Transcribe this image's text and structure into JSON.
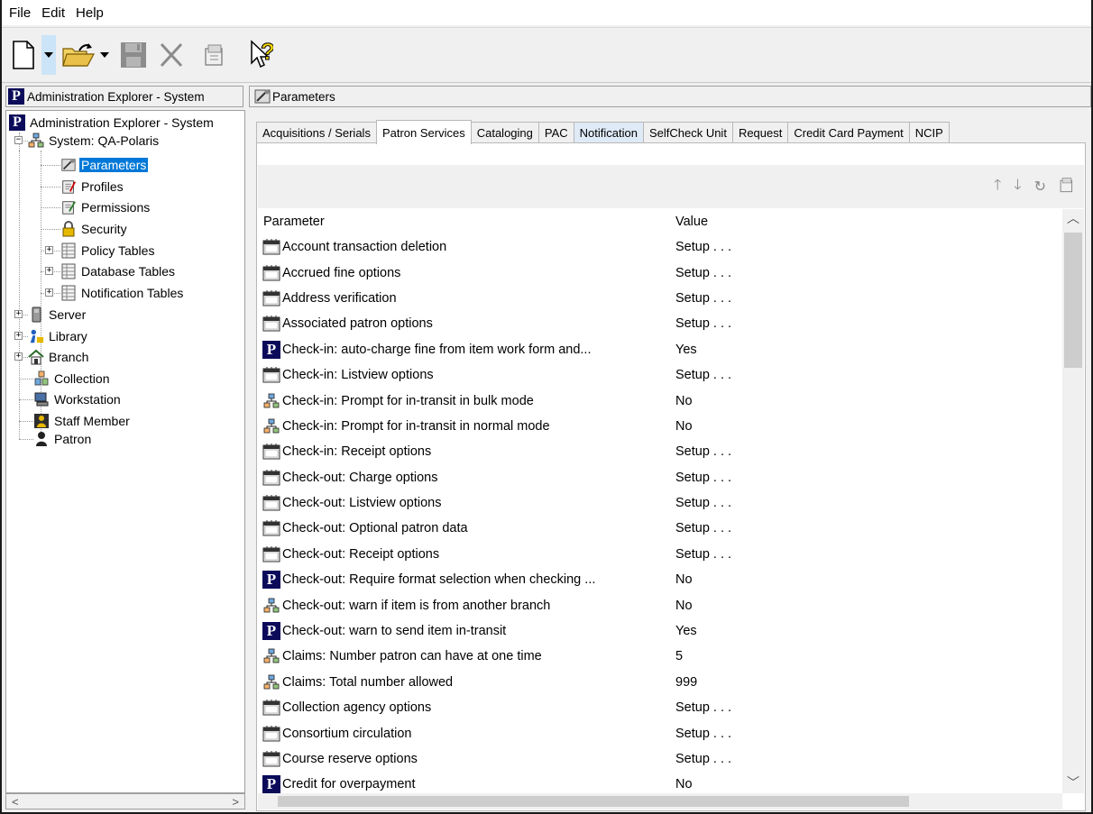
{
  "menu": [
    "File",
    "Edit",
    "Help"
  ],
  "toolbar": {
    "icons": [
      "new-document-icon",
      "open-folder-icon",
      "save-icon",
      "delete-icon",
      "properties-icon",
      "whats-this-help-icon"
    ]
  },
  "left_pane": {
    "header": "Administration Explorer - System",
    "tree": {
      "root": "Administration Explorer - System",
      "system": "System: QA-Polaris",
      "parameters": "Parameters",
      "profiles": "Profiles",
      "permissions": "Permissions",
      "security": "Security",
      "policy_tables": "Policy Tables",
      "database_tables": "Database Tables",
      "notification_tables": "Notification Tables",
      "server": "Server",
      "library": "Library",
      "branch": "Branch",
      "collection": "Collection",
      "workstation": "Workstation",
      "staff_member": "Staff Member",
      "patron": "Patron"
    },
    "selected": "Parameters"
  },
  "right_pane": {
    "header": "Parameters",
    "tabs": [
      "Acquisitions / Serials",
      "Patron Services",
      "Cataloging",
      "PAC",
      "Notification",
      "SelfCheck Unit",
      "Request",
      "Credit Card Payment",
      "NCIP"
    ],
    "selected_tab": "Patron Services",
    "hover_tab": "Notification",
    "list_toolbar_icons": [
      "arrow-up-icon",
      "arrow-down-icon",
      "refresh-icon",
      "properties-icon"
    ],
    "columns": {
      "parameter": "Parameter",
      "value": "Value"
    },
    "rows": [
      {
        "icon": "setup",
        "name": "Account transaction deletion",
        "value": "Setup . . ."
      },
      {
        "icon": "setup",
        "name": "Accrued fine options",
        "value": "Setup . . ."
      },
      {
        "icon": "setup",
        "name": "Address verification",
        "value": "Setup . . ."
      },
      {
        "icon": "setup",
        "name": "Associated patron options",
        "value": "Setup . . ."
      },
      {
        "icon": "polaris",
        "name": "Check-in: auto-charge fine from item work form and...",
        "value": "Yes"
      },
      {
        "icon": "setup",
        "name": "Check-in: Listview options",
        "value": "Setup . . ."
      },
      {
        "icon": "network",
        "name": "Check-in: Prompt for in-transit in bulk mode",
        "value": "No"
      },
      {
        "icon": "network",
        "name": "Check-in: Prompt for in-transit in normal mode",
        "value": "No"
      },
      {
        "icon": "setup",
        "name": "Check-in: Receipt options",
        "value": "Setup . . ."
      },
      {
        "icon": "setup",
        "name": "Check-out: Charge options",
        "value": "Setup . . ."
      },
      {
        "icon": "setup",
        "name": "Check-out: Listview options",
        "value": "Setup . . ."
      },
      {
        "icon": "setup",
        "name": "Check-out: Optional patron data",
        "value": "Setup . . ."
      },
      {
        "icon": "setup",
        "name": "Check-out: Receipt options",
        "value": "Setup . . ."
      },
      {
        "icon": "polaris",
        "name": "Check-out: Require format selection when checking ...",
        "value": "No"
      },
      {
        "icon": "network",
        "name": "Check-out: warn if item is from another branch",
        "value": "No"
      },
      {
        "icon": "polaris",
        "name": "Check-out: warn to send item in-transit",
        "value": "Yes"
      },
      {
        "icon": "network",
        "name": "Claims: Number patron can have at one time",
        "value": "5"
      },
      {
        "icon": "network",
        "name": "Claims: Total number allowed",
        "value": "999"
      },
      {
        "icon": "setup",
        "name": "Collection agency options",
        "value": "Setup . . ."
      },
      {
        "icon": "setup",
        "name": "Consortium circulation",
        "value": "Setup . . ."
      },
      {
        "icon": "setup",
        "name": "Course reserve options",
        "value": "Setup . . ."
      },
      {
        "icon": "polaris",
        "name": "Credit for overpayment",
        "value": "No"
      }
    ]
  },
  "colors": {
    "selection": "#0078d7",
    "tab_hover": "#dfeaf7",
    "polaris_logo": "#0b0b5a"
  }
}
